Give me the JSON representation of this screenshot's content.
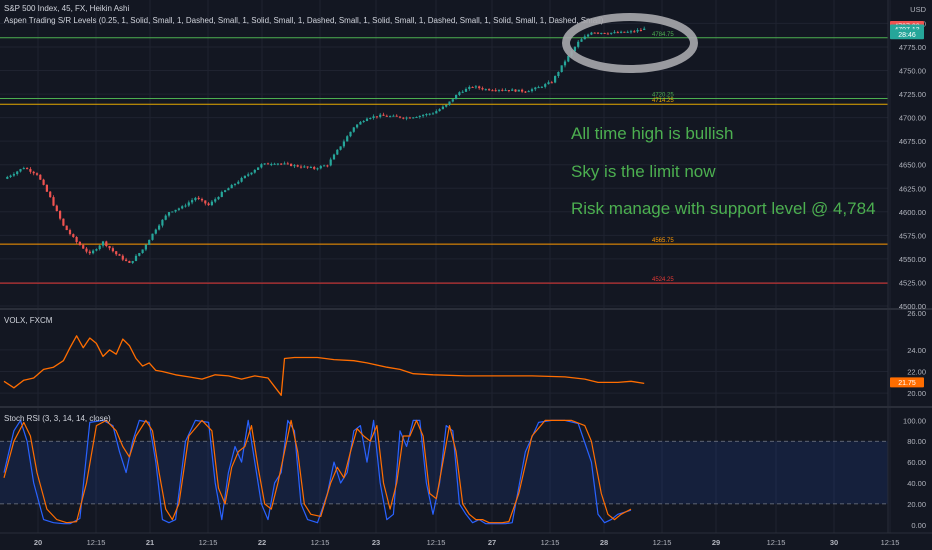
{
  "chart_data": [
    {
      "type": "candlestick",
      "title": "S&P 500 Index, 45, FX, Heikin Ashi",
      "indicator_label": "Aspen Trading S/R Levels (0.25, 1, Solid, Small, 1, Dashed, Small, 1, Solid, Small, 1, Dashed, Small, 1, Solid, Small, 1, Dashed, Small, 1, Solid, Small, 1, Dashed, Small)",
      "currency": "USD",
      "ylim": [
        4500,
        4810
      ],
      "yticks": [
        "4800.00",
        "4775.00",
        "4750.00",
        "4725.00",
        "4700.00",
        "4675.00",
        "4650.00",
        "4625.00",
        "4600.00",
        "4575.00",
        "4550.00",
        "4525.00",
        "4500.00"
      ],
      "price_tags": [
        {
          "text": "4797.28",
          "value": 4797.28,
          "color": "#ef5350"
        },
        {
          "text": "4797.13",
          "value": 4793.5,
          "color": "#26a69a"
        },
        {
          "text": "28:46",
          "value": 4788.5,
          "color": "#26a69a"
        }
      ],
      "levels": [
        {
          "label": "4784.75",
          "value": 4784.75,
          "color": "#4caf50"
        },
        {
          "label": "4720.25",
          "value": 4720.25,
          "color": "#4caf50"
        },
        {
          "label": "4714.25",
          "value": 4714.25,
          "color": "#e5a800"
        },
        {
          "label": "4565.75",
          "value": 4565.75,
          "color": "#ff9800"
        },
        {
          "label": "4524.25",
          "value": 4524.25,
          "color": "#e53935"
        }
      ],
      "waypoints": [
        [
          0,
          4635
        ],
        [
          6,
          4647
        ],
        [
          10,
          4640
        ],
        [
          14,
          4615
        ],
        [
          18,
          4585
        ],
        [
          22,
          4568
        ],
        [
          26,
          4555
        ],
        [
          30,
          4568
        ],
        [
          34,
          4555
        ],
        [
          38,
          4545
        ],
        [
          42,
          4560
        ],
        [
          46,
          4582
        ],
        [
          50,
          4600
        ],
        [
          54,
          4605
        ],
        [
          58,
          4615
        ],
        [
          62,
          4607
        ],
        [
          66,
          4620
        ],
        [
          70,
          4630
        ],
        [
          74,
          4640
        ],
        [
          78,
          4650
        ],
        [
          82,
          4652
        ],
        [
          86,
          4650
        ],
        [
          90,
          4648
        ],
        [
          94,
          4646
        ],
        [
          98,
          4650
        ],
        [
          102,
          4670
        ],
        [
          106,
          4690
        ],
        [
          110,
          4700
        ],
        [
          114,
          4702
        ],
        [
          118,
          4701
        ],
        [
          122,
          4700
        ],
        [
          126,
          4702
        ],
        [
          130,
          4705
        ],
        [
          134,
          4713
        ],
        [
          138,
          4727
        ],
        [
          142,
          4733
        ],
        [
          146,
          4730
        ],
        [
          150,
          4730
        ],
        [
          154,
          4729
        ],
        [
          158,
          4728
        ],
        [
          162,
          4732
        ],
        [
          166,
          4738
        ],
        [
          170,
          4760
        ],
        [
          174,
          4780
        ],
        [
          178,
          4791
        ],
        [
          182,
          4790
        ],
        [
          186,
          4790
        ],
        [
          190,
          4791
        ],
        [
          194,
          4794
        ]
      ],
      "x_ticks": [
        "20",
        "12:15",
        "21",
        "12:15",
        "22",
        "12:15",
        "23",
        "12:15",
        "27",
        "12:15",
        "28",
        "12:15",
        "29",
        "12:15",
        "30",
        "12:15"
      ],
      "annotations": [
        "All time high is bullish",
        "Sky is the limit now",
        "Risk manage with support level @ 4,784"
      ]
    },
    {
      "type": "line",
      "title": "VOLX, FXCM",
      "ylim": [
        19,
        27.5
      ],
      "yticks": [
        "24.00",
        "22.00",
        "20.00"
      ],
      "top_label": "26.00",
      "last_tag": "21.75",
      "series": [
        {
          "color": "#ff6d00",
          "values": [
            [
              0,
              21.1
            ],
            [
              3,
              20.5
            ],
            [
              6,
              21.2
            ],
            [
              9,
              21.4
            ],
            [
              12,
              22.2
            ],
            [
              15,
              22.4
            ],
            [
              18,
              23.0
            ],
            [
              20,
              24.2
            ],
            [
              22,
              25.3
            ],
            [
              24,
              24.2
            ],
            [
              26,
              25.1
            ],
            [
              28,
              24.6
            ],
            [
              30,
              23.4
            ],
            [
              32,
              24.0
            ],
            [
              34,
              23.6
            ],
            [
              36,
              25.0
            ],
            [
              38,
              24.4
            ],
            [
              40,
              23.2
            ],
            [
              42,
              22.5
            ],
            [
              44,
              22.8
            ],
            [
              46,
              22.1
            ],
            [
              48,
              22.0
            ],
            [
              52,
              21.7
            ],
            [
              56,
              21.5
            ],
            [
              60,
              21.3
            ],
            [
              64,
              21.7
            ],
            [
              68,
              21.6
            ],
            [
              72,
              21.3
            ],
            [
              76,
              21.6
            ],
            [
              80,
              21.4
            ],
            [
              82,
              20.6
            ],
            [
              84,
              19.8
            ],
            [
              85,
              23.2
            ],
            [
              88,
              23.3
            ],
            [
              95,
              23.3
            ],
            [
              100,
              23.1
            ],
            [
              106,
              23.0
            ],
            [
              110,
              22.8
            ],
            [
              116,
              22.4
            ],
            [
              120,
              22.2
            ],
            [
              124,
              21.8
            ],
            [
              130,
              21.7
            ],
            [
              140,
              21.6
            ],
            [
              150,
              21.6
            ],
            [
              160,
              21.6
            ],
            [
              170,
              21.5
            ],
            [
              176,
              21.3
            ],
            [
              180,
              21.0
            ],
            [
              186,
              21.0
            ],
            [
              190,
              21.1
            ],
            [
              194,
              20.9
            ]
          ]
        }
      ]
    },
    {
      "type": "line",
      "title": "Stoch RSI (3, 3, 14, 14, close)",
      "ylim": [
        -5,
        108
      ],
      "yticks": [
        "100.00",
        "80.00",
        "60.00",
        "40.00",
        "20.00",
        "0.00"
      ],
      "band": [
        20,
        80
      ],
      "series": [
        {
          "color": "#2962ff",
          "values": [
            [
              0,
              50
            ],
            [
              3,
              90
            ],
            [
              5,
              100
            ],
            [
              7,
              80
            ],
            [
              9,
              40
            ],
            [
              12,
              5
            ],
            [
              15,
              2
            ],
            [
              18,
              1
            ],
            [
              20,
              1
            ],
            [
              23,
              6
            ],
            [
              26,
              98
            ],
            [
              30,
              100
            ],
            [
              33,
              95
            ],
            [
              35,
              70
            ],
            [
              37,
              50
            ],
            [
              39,
              80
            ],
            [
              41,
              100
            ],
            [
              44,
              98
            ],
            [
              46,
              60
            ],
            [
              48,
              5
            ],
            [
              50,
              2
            ],
            [
              52,
              5
            ],
            [
              55,
              80
            ],
            [
              58,
              100
            ],
            [
              62,
              98
            ],
            [
              64,
              40
            ],
            [
              66,
              5
            ],
            [
              68,
              50
            ],
            [
              70,
              75
            ],
            [
              72,
              60
            ],
            [
              74,
              100
            ],
            [
              76,
              60
            ],
            [
              78,
              20
            ],
            [
              80,
              5
            ],
            [
              82,
              40
            ],
            [
              84,
              50
            ],
            [
              86,
              100
            ],
            [
              88,
              90
            ],
            [
              90,
              20
            ],
            [
              92,
              5
            ],
            [
              95,
              2
            ],
            [
              98,
              30
            ],
            [
              100,
              60
            ],
            [
              102,
              40
            ],
            [
              104,
              50
            ],
            [
              106,
              90
            ],
            [
              108,
              95
            ],
            [
              110,
              60
            ],
            [
              112,
              100
            ],
            [
              114,
              40
            ],
            [
              116,
              5
            ],
            [
              118,
              10
            ],
            [
              120,
              90
            ],
            [
              122,
              75
            ],
            [
              124,
              100
            ],
            [
              126,
              100
            ],
            [
              128,
              40
            ],
            [
              130,
              10
            ],
            [
              132,
              40
            ],
            [
              134,
              95
            ],
            [
              136,
              90
            ],
            [
              138,
              20
            ],
            [
              140,
              10
            ],
            [
              142,
              2
            ],
            [
              144,
              5
            ],
            [
              146,
              1
            ],
            [
              148,
              1
            ],
            [
              150,
              1
            ],
            [
              152,
              1
            ],
            [
              154,
              2
            ],
            [
              158,
              70
            ],
            [
              162,
              98
            ],
            [
              166,
              100
            ],
            [
              170,
              100
            ],
            [
              174,
              97
            ],
            [
              178,
              60
            ],
            [
              180,
              10
            ],
            [
              182,
              2
            ],
            [
              184,
              5
            ],
            [
              186,
              10
            ],
            [
              190,
              14
            ]
          ]
        },
        {
          "color": "#ff6d00",
          "values": [
            [
              0,
              45
            ],
            [
              3,
              80
            ],
            [
              6,
              98
            ],
            [
              8,
              85
            ],
            [
              10,
              50
            ],
            [
              13,
              15
            ],
            [
              16,
              5
            ],
            [
              19,
              2
            ],
            [
              22,
              3
            ],
            [
              25,
              40
            ],
            [
              28,
              95
            ],
            [
              31,
              100
            ],
            [
              34,
              90
            ],
            [
              36,
              75
            ],
            [
              38,
              65
            ],
            [
              40,
              85
            ],
            [
              43,
              100
            ],
            [
              45,
              90
            ],
            [
              47,
              50
            ],
            [
              49,
              15
            ],
            [
              51,
              5
            ],
            [
              53,
              20
            ],
            [
              56,
              85
            ],
            [
              60,
              100
            ],
            [
              63,
              90
            ],
            [
              65,
              35
            ],
            [
              67,
              20
            ],
            [
              69,
              55
            ],
            [
              71,
              70
            ],
            [
              73,
              75
            ],
            [
              75,
              95
            ],
            [
              77,
              55
            ],
            [
              79,
              20
            ],
            [
              81,
              15
            ],
            [
              83,
              40
            ],
            [
              85,
              70
            ],
            [
              87,
              100
            ],
            [
              89,
              70
            ],
            [
              91,
              20
            ],
            [
              93,
              10
            ],
            [
              96,
              8
            ],
            [
              99,
              40
            ],
            [
              101,
              55
            ],
            [
              103,
              45
            ],
            [
              105,
              70
            ],
            [
              107,
              92
            ],
            [
              109,
              85
            ],
            [
              111,
              80
            ],
            [
              113,
              95
            ],
            [
              115,
              40
            ],
            [
              117,
              15
            ],
            [
              119,
              40
            ],
            [
              121,
              85
            ],
            [
              123,
              85
            ],
            [
              125,
              100
            ],
            [
              127,
              85
            ],
            [
              129,
              30
            ],
            [
              131,
              25
            ],
            [
              133,
              60
            ],
            [
              135,
              95
            ],
            [
              137,
              70
            ],
            [
              139,
              20
            ],
            [
              141,
              10
            ],
            [
              143,
              5
            ],
            [
              145,
              5
            ],
            [
              147,
              2
            ],
            [
              149,
              2
            ],
            [
              151,
              2
            ],
            [
              153,
              3
            ],
            [
              156,
              30
            ],
            [
              160,
              85
            ],
            [
              164,
              100
            ],
            [
              168,
              100
            ],
            [
              172,
              100
            ],
            [
              176,
              95
            ],
            [
              178,
              80
            ],
            [
              181,
              30
            ],
            [
              183,
              10
            ],
            [
              185,
              5
            ],
            [
              187,
              10
            ],
            [
              190,
              15
            ]
          ]
        }
      ]
    }
  ]
}
